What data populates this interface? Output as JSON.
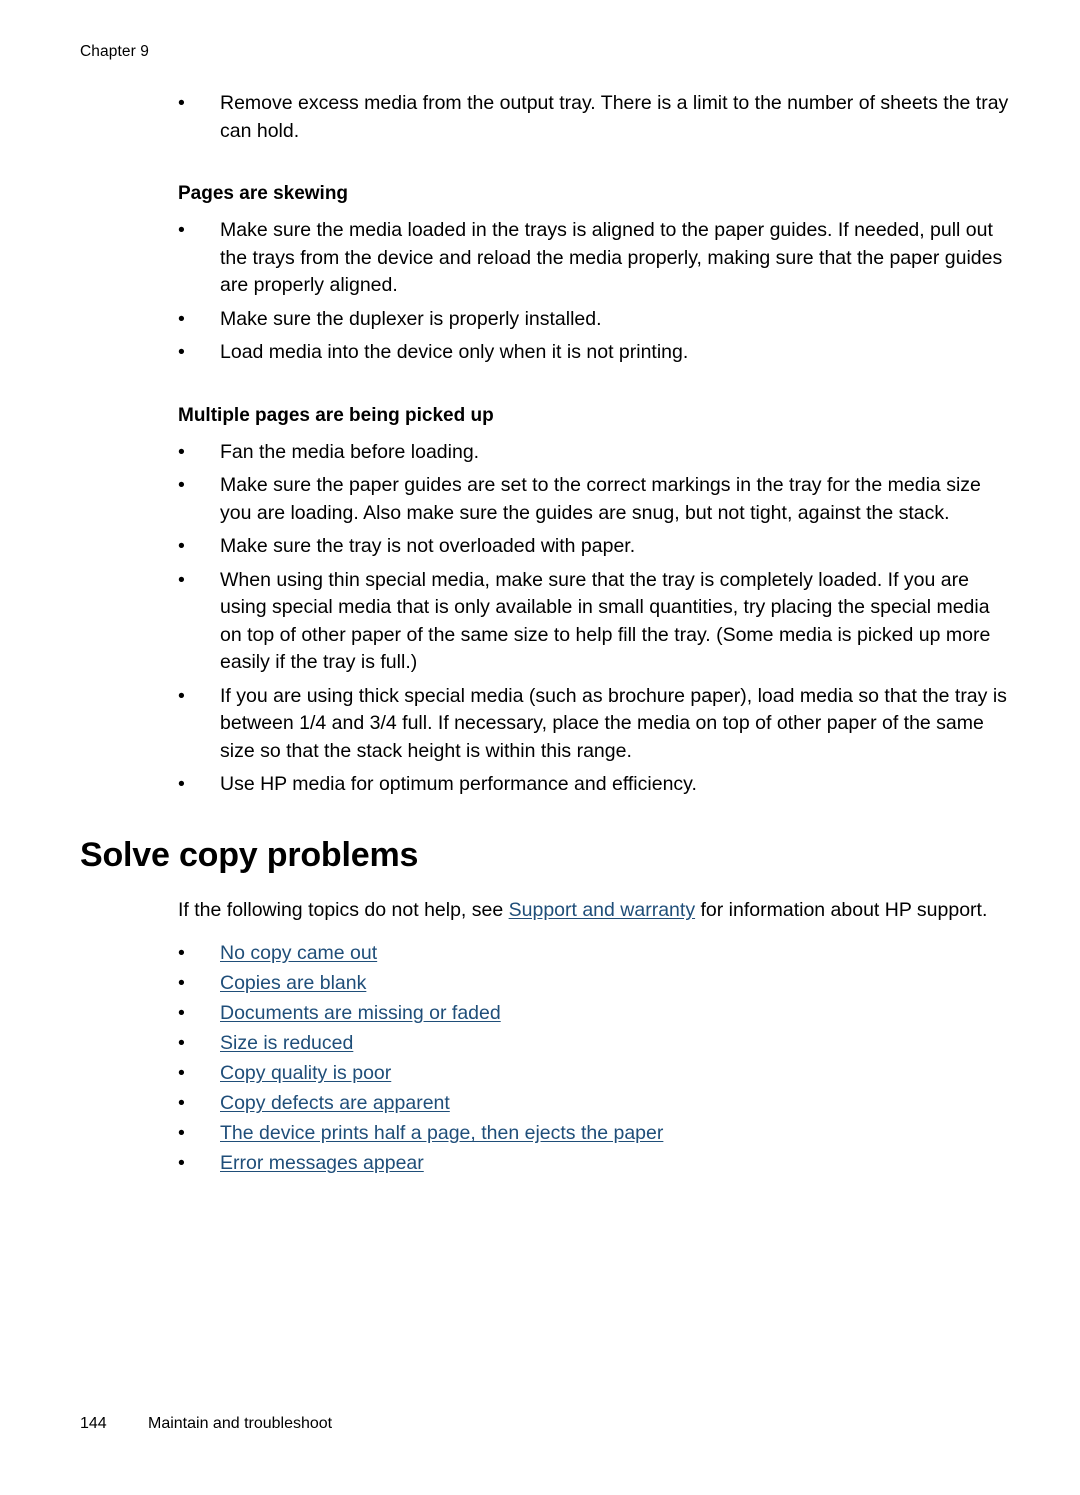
{
  "page": {
    "running_header": "Chapter 9",
    "background_color": "#ffffff",
    "text_color": "#000000",
    "link_color": "#1f4e79"
  },
  "intro_bullets": [
    {
      "marker": "•",
      "text": "Remove excess media from the output tray. There is a limit to the number of sheets the tray can hold."
    }
  ],
  "sections": [
    {
      "heading": "Pages are skewing",
      "bullets": [
        {
          "marker": "•",
          "text": "Make sure the media loaded in the trays is aligned to the paper guides. If needed, pull out the trays from the device and reload the media properly, making sure that the paper guides are properly aligned."
        },
        {
          "marker": "•",
          "text": "Make sure the duplexer is properly installed."
        },
        {
          "marker": "•",
          "text": "Load media into the device only when it is not printing."
        }
      ]
    },
    {
      "heading": "Multiple pages are being picked up",
      "bullets": [
        {
          "marker": "•",
          "text": "Fan the media before loading."
        },
        {
          "marker": "•",
          "text": "Make sure the paper guides are set to the correct markings in the tray for the media size you are loading. Also make sure the guides are snug, but not tight, against the stack."
        },
        {
          "marker": "•",
          "text": "Make sure the tray is not overloaded with paper."
        },
        {
          "marker": "•",
          "text": "When using thin special media, make sure that the tray is completely loaded. If you are using special media that is only available in small quantities, try placing the special media on top of other paper of the same size to help fill the tray. (Some media is picked up more easily if the tray is full.)"
        },
        {
          "marker": "•",
          "text": "If you are using thick special media (such as brochure paper), load media so that the tray is between 1/4 and 3/4 full. If necessary, place the media on top of other paper of the same size so that the stack height is within this range."
        },
        {
          "marker": "•",
          "text": "Use HP media for optimum performance and efficiency."
        }
      ]
    }
  ],
  "copy_section": {
    "heading": "Solve copy problems",
    "intro_before_link": "If the following topics do not help, see ",
    "intro_link": "Support and warranty",
    "intro_after_link": " for information about HP support.",
    "topics": [
      {
        "marker": "•",
        "label": "No copy came out"
      },
      {
        "marker": "•",
        "label": "Copies are blank"
      },
      {
        "marker": "•",
        "label": "Documents are missing or faded"
      },
      {
        "marker": "•",
        "label": "Size is reduced"
      },
      {
        "marker": "•",
        "label": "Copy quality is poor"
      },
      {
        "marker": "•",
        "label": "Copy defects are apparent"
      },
      {
        "marker": "•",
        "label": "The device prints half a page, then ejects the paper"
      },
      {
        "marker": "•",
        "label": "Error messages appear"
      }
    ]
  },
  "footer": {
    "page_number": "144",
    "title": "Maintain and troubleshoot"
  }
}
